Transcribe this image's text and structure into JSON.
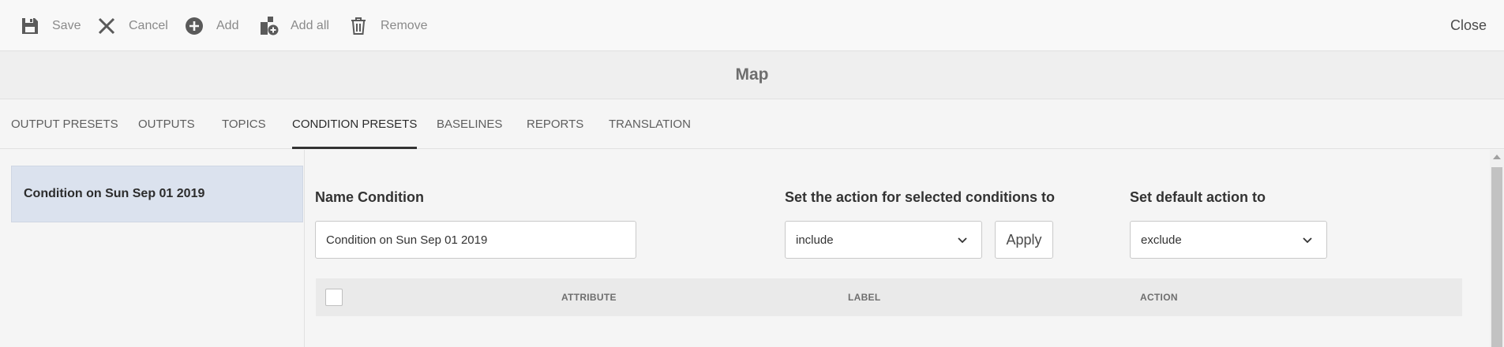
{
  "toolbar": {
    "save_label": "Save",
    "cancel_label": "Cancel",
    "add_label": "Add",
    "add_all_label": "Add all",
    "remove_label": "Remove",
    "close_label": "Close"
  },
  "title": "Map",
  "tabs": [
    {
      "label": "OUTPUT PRESETS"
    },
    {
      "label": "OUTPUTS"
    },
    {
      "label": "TOPICS"
    },
    {
      "label": "CONDITION PRESETS",
      "active": true
    },
    {
      "label": "BASELINES"
    },
    {
      "label": "REPORTS"
    },
    {
      "label": "TRANSLATION"
    }
  ],
  "presets": [
    {
      "label": "Condition on Sun Sep 01 2019",
      "selected": true
    }
  ],
  "form": {
    "name_label": "Name Condition",
    "name_value": "Condition on Sun Sep 01 2019",
    "action_label": "Set the action for selected conditions to",
    "action_value": "include",
    "apply_label": "Apply",
    "default_label": "Set default action to",
    "default_value": "exclude"
  },
  "table": {
    "columns": [
      "ATTRIBUTE",
      "LABEL",
      "ACTION"
    ],
    "rows": []
  },
  "icons": {
    "save": "floppy-disk-icon",
    "cancel": "close-icon",
    "add": "plus-circle-icon",
    "add_all": "add-all-icon",
    "remove": "trash-icon",
    "select": "chevron-down-icon"
  }
}
